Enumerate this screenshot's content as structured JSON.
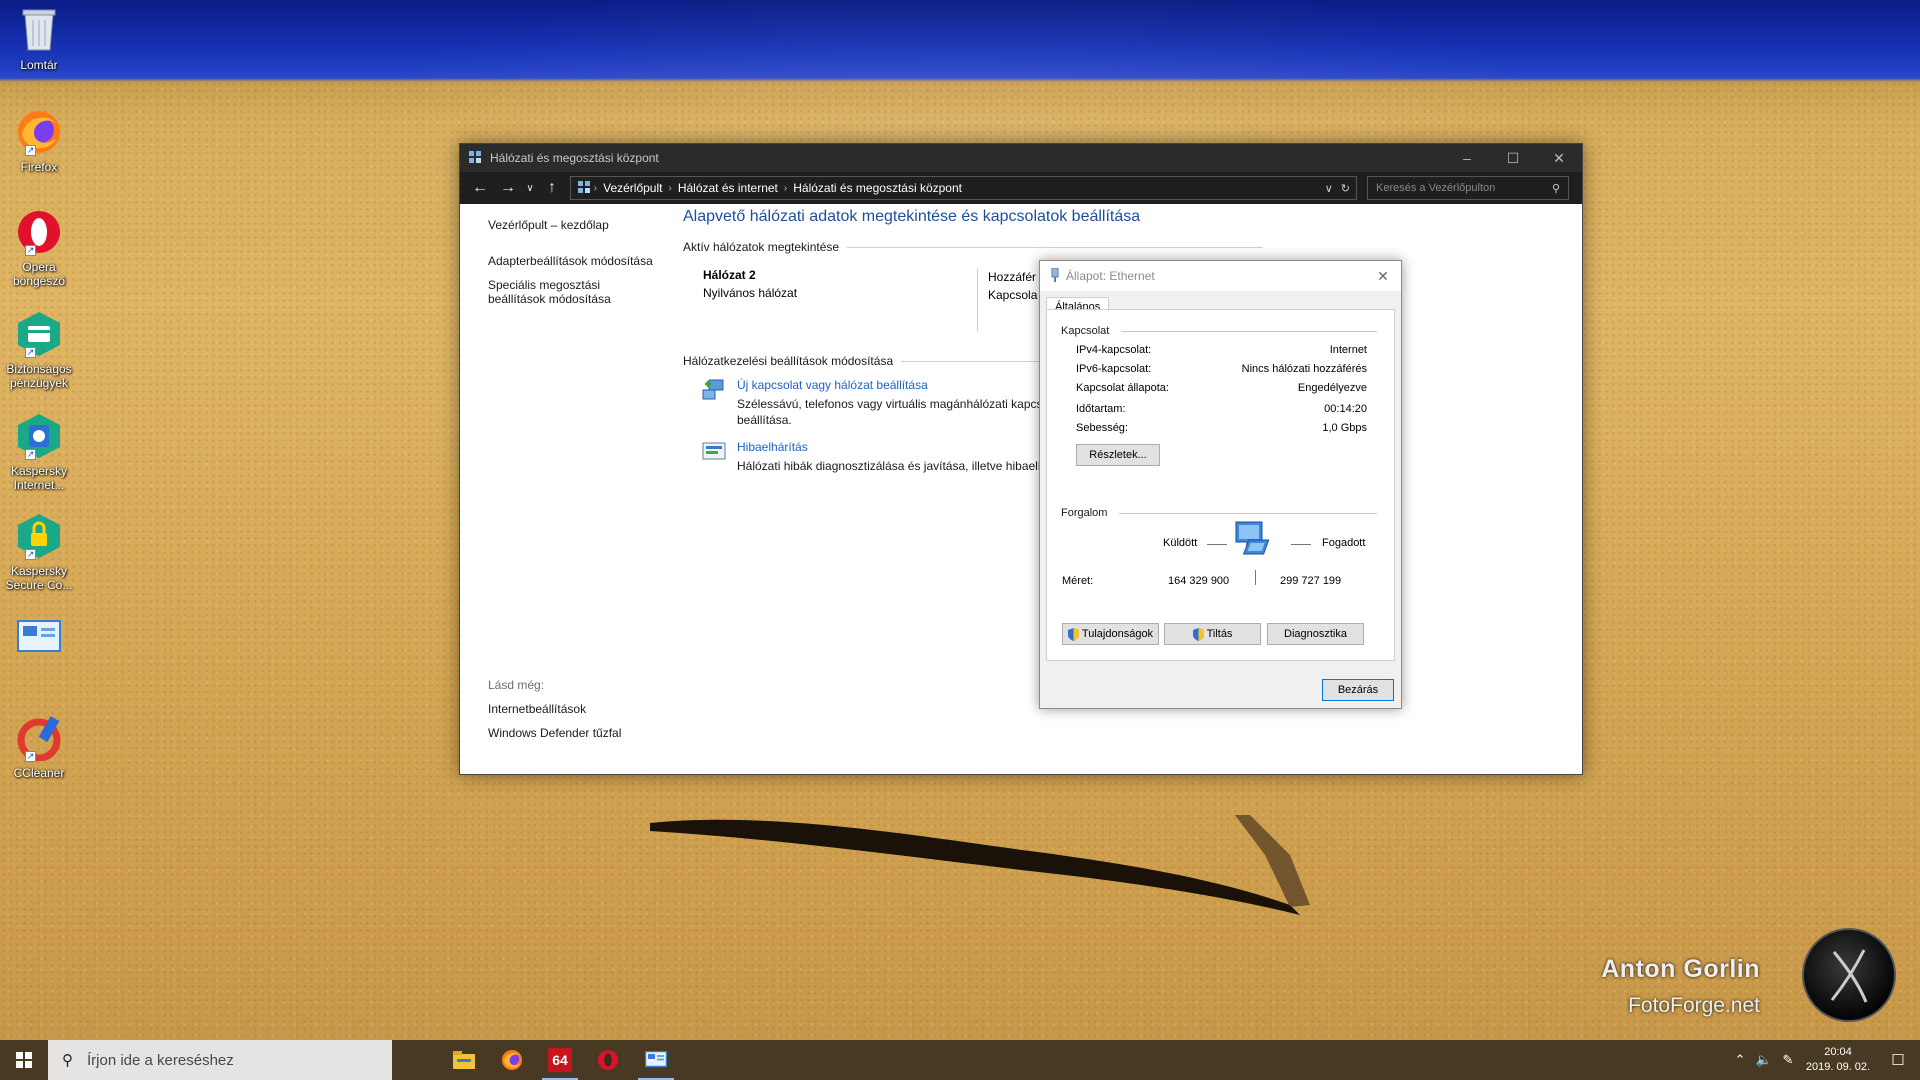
{
  "desktop": {
    "icons": [
      {
        "label": "Lomtár",
        "icon": "recycle-bin-icon"
      },
      {
        "label": "Firefox",
        "icon": "firefox-icon"
      },
      {
        "label": "Opera böngésző",
        "icon": "opera-icon"
      },
      {
        "label": "Biztonságos pénzügyek",
        "icon": "safe-money-icon"
      },
      {
        "label": "Kaspersky Internet...",
        "icon": "kaspersky-internet-icon"
      },
      {
        "label": "Kaspersky Secure Co...",
        "icon": "kaspersky-secure-icon"
      },
      {
        "label": "",
        "icon": "monitor-app-icon"
      },
      {
        "label": "CCleaner",
        "icon": "ccleaner-icon"
      }
    ],
    "watermark": {
      "name": "Anton Gorlin",
      "site": "FotoForge.net"
    }
  },
  "window": {
    "title": "Hálózati és megosztási központ",
    "breadcrumbs": [
      "Vezérlőpult",
      "Hálózat és internet",
      "Hálózati és megosztási központ"
    ],
    "search_placeholder": "Keresés a Vezérlőpulton",
    "left": {
      "home": "Vezérlőpult – kezdőlap",
      "links": [
        "Adapterbeállítások módosítása",
        "Speciális megosztási beállítások módosítása"
      ],
      "see_also_header": "Lásd még:",
      "see_also": [
        "Internetbeállítások",
        "Windows Defender tűzfal"
      ]
    },
    "main": {
      "heading": "Alapvető hálózati adatok megtekintése és kapcsolatok beállítása",
      "active_header": "Aktív hálózatok megtekintése",
      "network_name": "Hálózat 2",
      "network_type": "Nyilvános hálózat",
      "access_label": "Hozzáfér",
      "connection_label": "Kapcsola",
      "change_header": "Hálózatkezelési beállítások módosítása",
      "tasks": [
        {
          "link": "Új kapcsolat vagy hálózat beállítása",
          "desc": "Szélessávú, telefonos vagy virtuális magánhálózati kapcso beállítása."
        },
        {
          "link": "Hibaelhárítás",
          "desc": "Hálózati hibák diagnosztizálása és javítása, illetve hibaelh"
        }
      ]
    }
  },
  "dialog": {
    "title": "Állapot: Ethernet",
    "tab": "Általános",
    "connection_group": "Kapcsolat",
    "rows": [
      {
        "k": "IPv4-kapcsolat:",
        "v": "Internet"
      },
      {
        "k": "IPv6-kapcsolat:",
        "v": "Nincs hálózati hozzáférés"
      },
      {
        "k": "Kapcsolat állapota:",
        "v": "Engedélyezve"
      },
      {
        "k": "Időtartam:",
        "v": "00:14:20"
      },
      {
        "k": "Sebesség:",
        "v": "1,0 Gbps"
      }
    ],
    "details_button": "Részletek...",
    "traffic_group": "Forgalom",
    "sent_label": "Küldött",
    "received_label": "Fogadott",
    "size_label": "Méret:",
    "sent_value": "164 329 900",
    "received_value": "299 727 199",
    "properties_button": "Tulajdonságok",
    "disable_button": "Tiltás",
    "diagnose_button": "Diagnosztika",
    "close_button": "Bezárás"
  },
  "taskbar": {
    "search_placeholder": "Írjon ide a kereséshez",
    "apps": [
      "file-explorer-icon",
      "firefox-icon",
      "aida64-icon",
      "opera-icon",
      "control-panel-icon"
    ],
    "aida_label": "64",
    "time": "20:04",
    "date": "2019. 09. 02."
  }
}
